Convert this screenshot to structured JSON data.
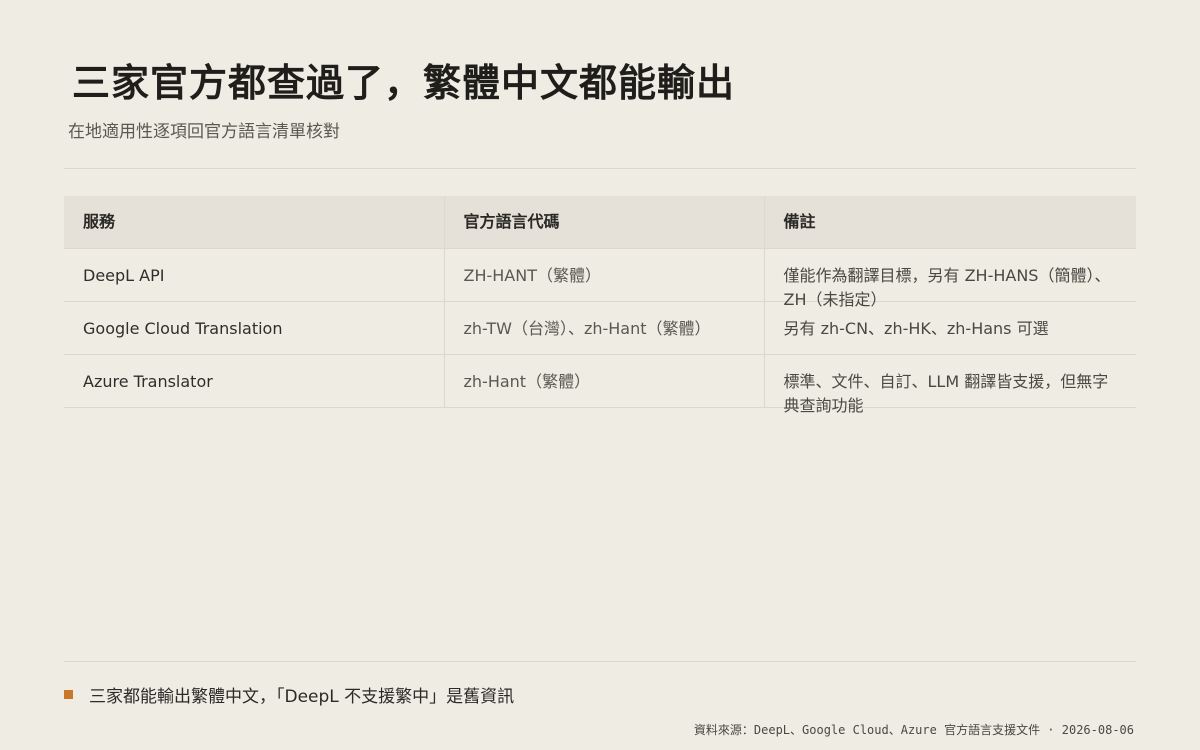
{
  "header": {
    "title": "三家官方都查過了，繁體中文都能輸出",
    "subtitle": "在地適用性逐項回官方語言清單核對"
  },
  "table": {
    "columns": [
      "服務",
      "官方語言代碼",
      "備註"
    ],
    "rows": [
      {
        "service": "DeepL API",
        "code": "ZH-HANT（繁體）",
        "note": "僅能作為翻譯目標，另有 ZH-HANS（簡體）、ZH（未指定）"
      },
      {
        "service": "Google Cloud Translation",
        "code": "zh-TW（台灣）、zh-Hant（繁體）",
        "note": "另有 zh-CN、zh-HK、zh-Hans 可選"
      },
      {
        "service": "Azure Translator",
        "code": "zh-Hant（繁體）",
        "note": "標準、文件、自訂、LLM 翻譯皆支援，但無字典查詢功能"
      }
    ]
  },
  "footer": {
    "takeaway": "三家都能輸出繁體中文，「DeepL 不支援繁中」是舊資訊",
    "source": "資料來源：DeepL、Google Cloud、Azure 官方語言支援文件 · 2026-08-06"
  },
  "colors": {
    "background": "#efece4",
    "header_row": "#e5e1d8",
    "accent": "#c9782a"
  },
  "icons": {
    "takeaway_marker": "square-icon"
  }
}
